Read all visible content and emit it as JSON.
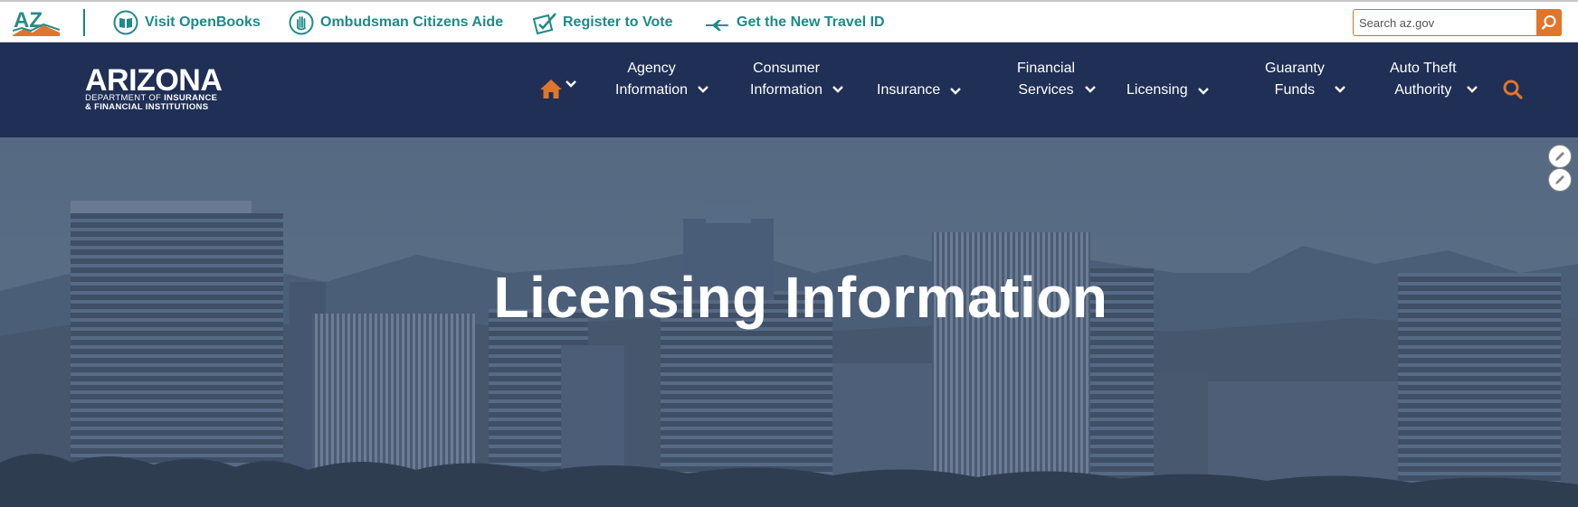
{
  "utility_bar": {
    "logo_text": "AZ",
    "links": [
      {
        "label": "Visit OpenBooks",
        "icon": "book-icon"
      },
      {
        "label": "Ombudsman Citizens Aide",
        "icon": "hand-icon"
      },
      {
        "label": "Register to Vote",
        "icon": "ballot-check-icon"
      },
      {
        "label": "Get the New Travel ID",
        "icon": "airplane-icon"
      }
    ],
    "search": {
      "placeholder": "Search az.gov",
      "value": ""
    }
  },
  "brand": {
    "name": "ARIZONA",
    "line1_prefix": "DEPARTMENT OF",
    "line1_bold": "INSURANCE",
    "line2": "& FINANCIAL INSTITUTIONS"
  },
  "nav": {
    "items": [
      {
        "line1": "Agency",
        "line2": "Information"
      },
      {
        "line1": "Consumer",
        "line2": "Information"
      },
      {
        "line1": "",
        "line2": "Insurance"
      },
      {
        "line1": "Financial",
        "line2": "Services"
      },
      {
        "line1": "",
        "line2": "Licensing"
      },
      {
        "line1": "Guaranty",
        "line2": "Funds"
      },
      {
        "line1": "Auto Theft",
        "line2": "Authority"
      }
    ]
  },
  "hero": {
    "title": "Licensing Information"
  },
  "colors": {
    "teal": "#1f8a87",
    "navy": "#1f2f55",
    "orange": "#e0762b"
  }
}
